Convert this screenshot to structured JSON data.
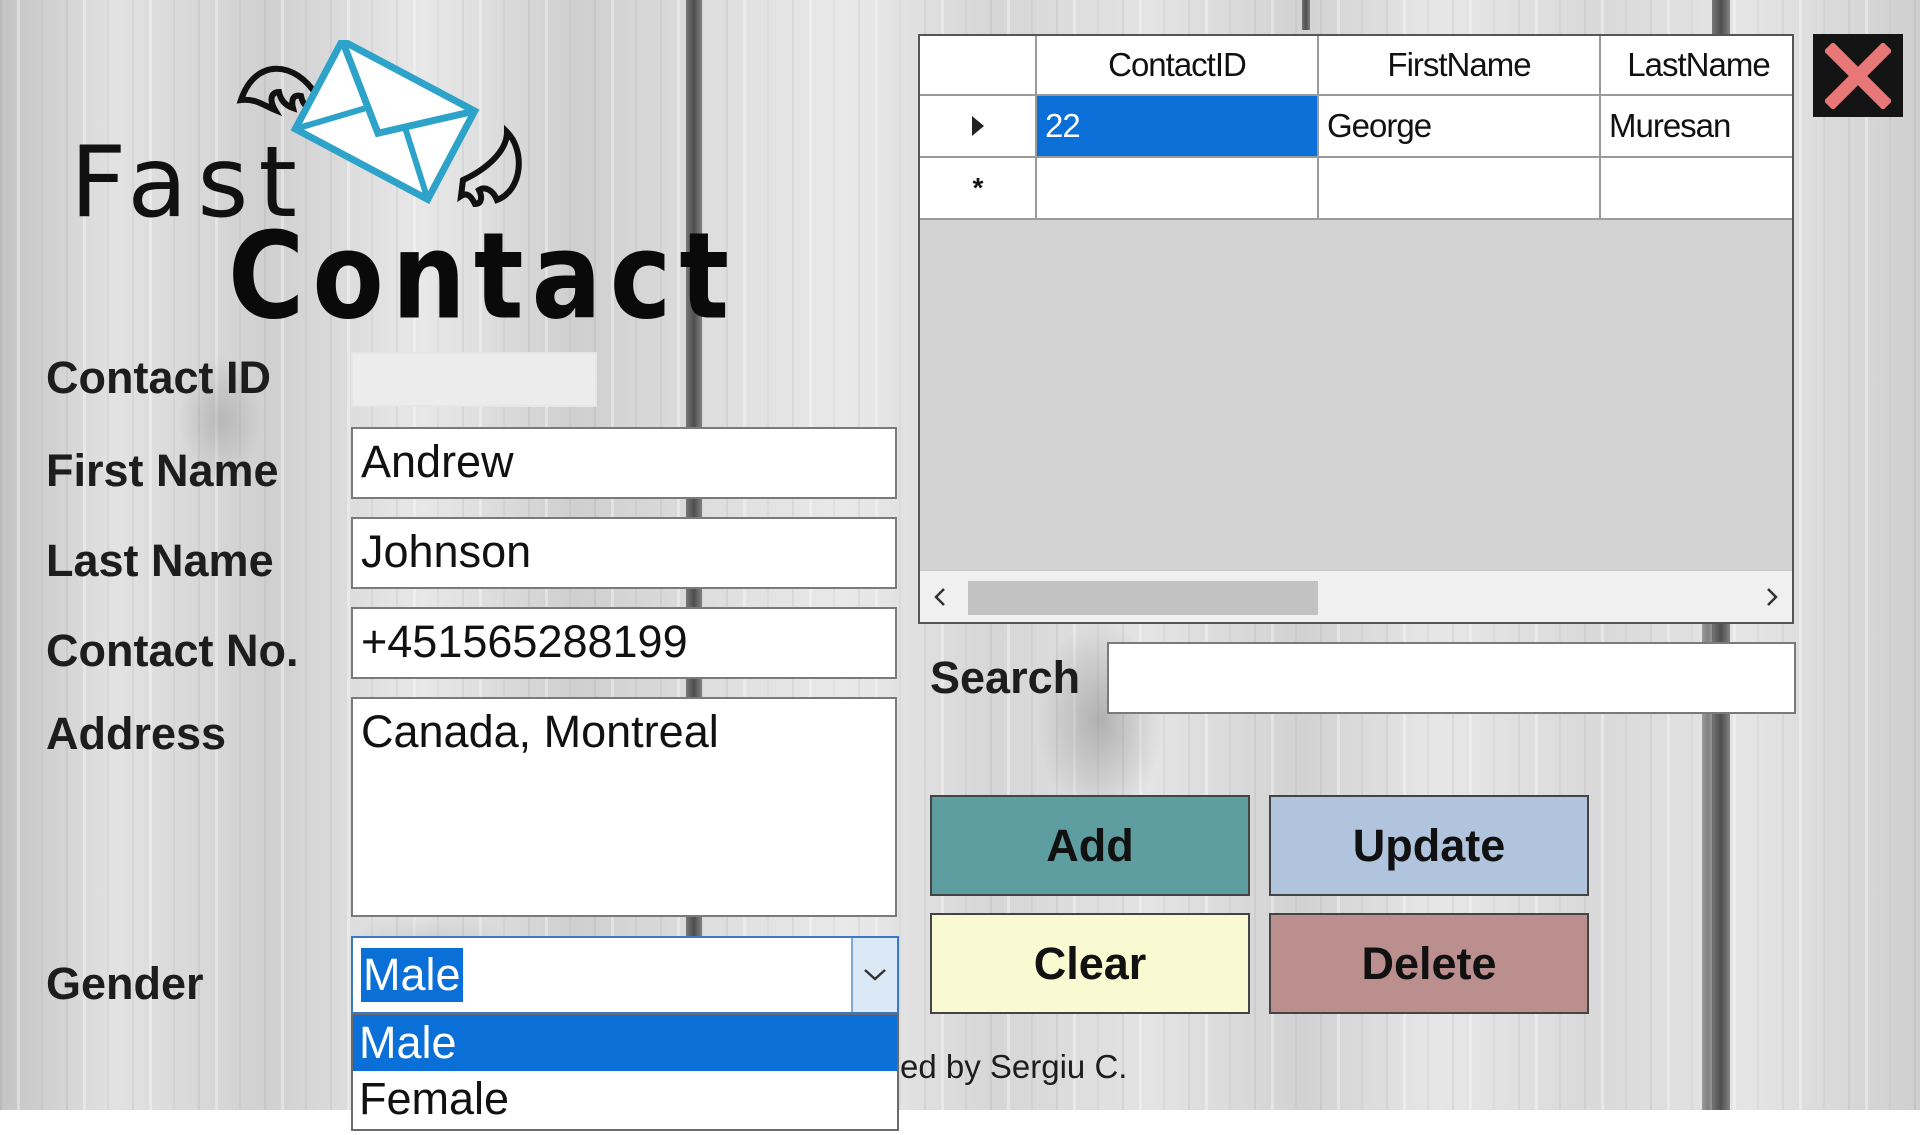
{
  "app": {
    "logo_line1": "Fast",
    "logo_line2": "Contact",
    "credit": "ed by Sergiu C."
  },
  "form": {
    "contact_id_label": "Contact ID",
    "contact_id_value": "",
    "first_name_label": "First Name",
    "first_name_value": "Andrew",
    "last_name_label": "Last Name",
    "last_name_value": "Johnson",
    "contact_no_label": "Contact No.",
    "contact_no_value": "+451565288199",
    "address_label": "Address",
    "address_value": "Canada, Montreal",
    "gender_label": "Gender",
    "gender_value": "Male",
    "gender_options": [
      "Male",
      "Female"
    ],
    "gender_highlighted": "Male"
  },
  "grid": {
    "columns": [
      "ContactID",
      "FirstName",
      "LastName"
    ],
    "rows": [
      {
        "contact_id": "22",
        "first_name": "George",
        "last_name": "Muresan"
      }
    ]
  },
  "search": {
    "label": "Search",
    "value": ""
  },
  "buttons": {
    "add": "Add",
    "update": "Update",
    "clear": "Clear",
    "delete": "Delete"
  },
  "colors": {
    "add_bg": "#5f9ea0",
    "update_bg": "#b0c4de",
    "clear_bg": "#fafad2",
    "delete_bg": "#bc8f8f",
    "selection_blue": "#0a6fd6",
    "close_x": "#e87878",
    "logo_envelope": "#2ea3c9"
  },
  "icons": {
    "close": "close-icon",
    "row_pointer": "row-pointer-icon",
    "new_row": "new-row-icon",
    "dropdown": "chevron-down-icon",
    "scroll_left": "chevron-left-icon",
    "scroll_right": "chevron-right-icon"
  }
}
